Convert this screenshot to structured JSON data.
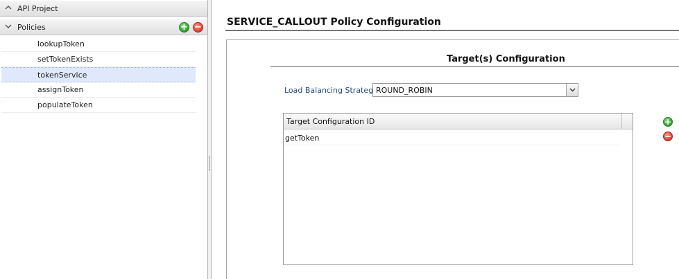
{
  "left_panel": {
    "api_project_header": "API Project",
    "policies_header": "Policies",
    "policies": [
      "lookupToken",
      "setTokenExists",
      "tokenService",
      "assignToken",
      "populateToken"
    ],
    "selected_policy": "tokenService",
    "add_icon": "plus-circle-icon",
    "remove_icon": "minus-circle-icon"
  },
  "main": {
    "title": "SERVICE_CALLOUT Policy Configuration",
    "section_title": "Target(s) Configuration",
    "load_balancing": {
      "label": "Load Balancing Strategy :",
      "value": "ROUND_ROBIN"
    },
    "targets_table": {
      "column_header": "Target Configuration ID",
      "rows": [
        "getToken"
      ]
    }
  },
  "colors": {
    "selected_row": "#dfe9fb",
    "label_blue": "#274b7a",
    "add_green": "#3aa537",
    "remove_red": "#e0493a"
  }
}
